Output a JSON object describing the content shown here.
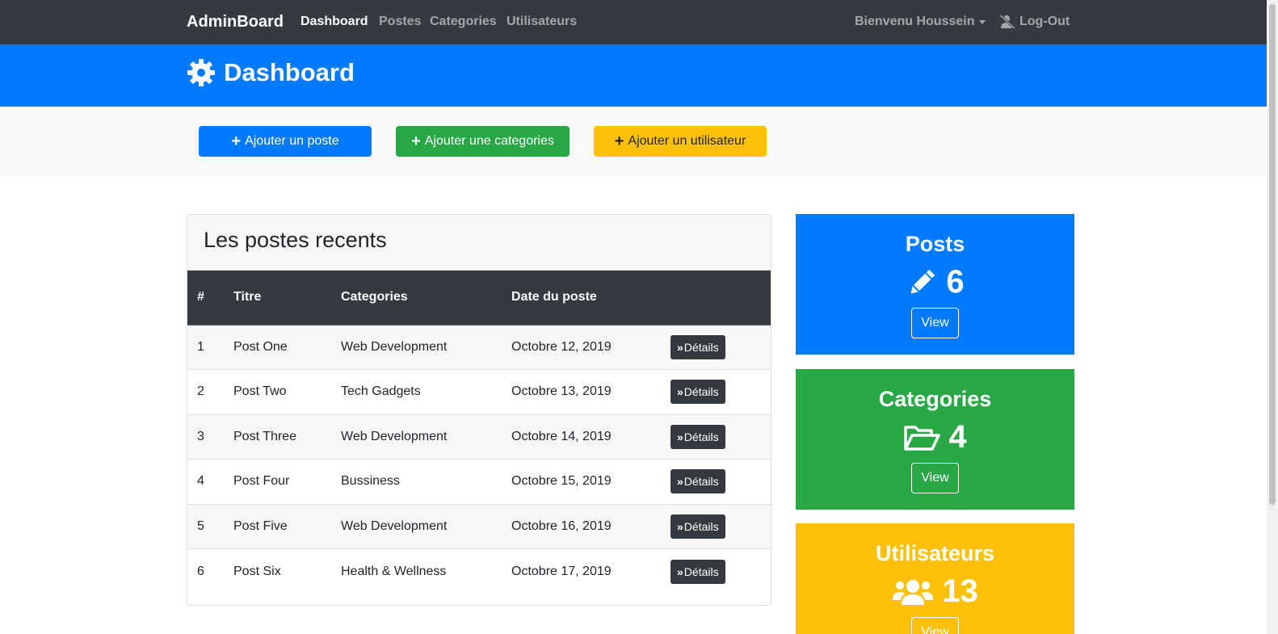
{
  "navbar": {
    "brand": "AdminBoard",
    "links": [
      "Dashboard",
      "Postes",
      "Categories",
      "Utilisateurs"
    ],
    "active": "Dashboard",
    "user_menu": "Bienvenu Houssein",
    "logout": "Log-Out"
  },
  "header": {
    "title": "Dashboard",
    "icon": "gear-icon"
  },
  "actions": {
    "add_post": "Ajouter un poste",
    "add_category": "Ajouter une categories",
    "add_user": "Ajouter un utilisateur"
  },
  "recent_posts": {
    "title": "Les postes recents",
    "columns": [
      "#",
      "Titre",
      "Categories",
      "Date du poste",
      ""
    ],
    "details_label": "Détails",
    "rows": [
      {
        "id": "1",
        "title": "Post One",
        "category": "Web Development",
        "date": "Octobre 12, 2019"
      },
      {
        "id": "2",
        "title": "Post Two",
        "category": "Tech Gadgets",
        "date": "Octobre 13, 2019"
      },
      {
        "id": "3",
        "title": "Post Three",
        "category": "Web Development",
        "date": "Octobre 14, 2019"
      },
      {
        "id": "4",
        "title": "Post Four",
        "category": "Bussiness",
        "date": "Octobre 15, 2019"
      },
      {
        "id": "5",
        "title": "Post Five",
        "category": "Web Development",
        "date": "Octobre 16, 2019"
      },
      {
        "id": "6",
        "title": "Post Six",
        "category": "Health & Wellness",
        "date": "Octobre 17, 2019"
      }
    ]
  },
  "stats": {
    "posts": {
      "title": "Posts",
      "value": "6",
      "button": "View",
      "icon": "pencil-icon",
      "color": "#007bff"
    },
    "categories": {
      "title": "Categories",
      "value": "4",
      "button": "View",
      "icon": "folder-open-icon",
      "color": "#28a745"
    },
    "users": {
      "title": "Utilisateurs",
      "value": "13",
      "button": "View",
      "icon": "users-icon",
      "color": "#ffc107"
    }
  },
  "colors": {
    "navbar": "#343a40",
    "primary": "#007bff",
    "success": "#28a745",
    "warning": "#ffc107",
    "light": "#f8f9fa"
  }
}
